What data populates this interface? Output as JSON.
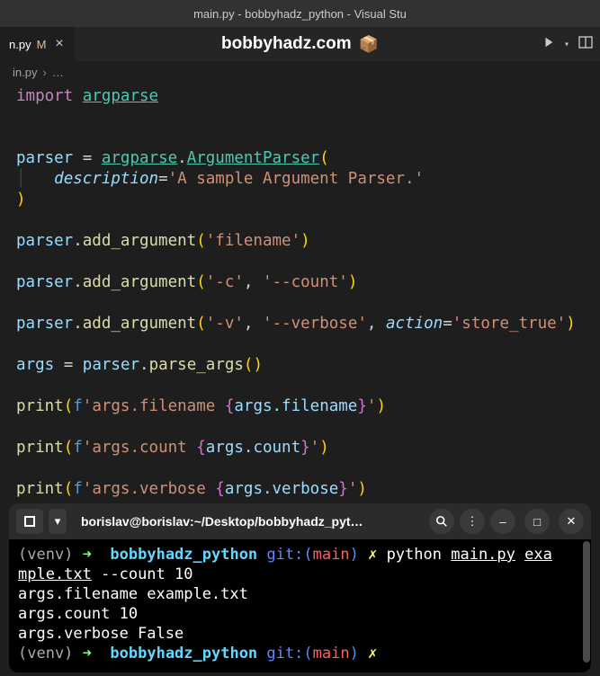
{
  "titlebar": {
    "text": "main.py - bobbyhadz_python - Visual Stu"
  },
  "tab": {
    "filename": "n.py",
    "modified_indicator": "M",
    "close_glyph": "×"
  },
  "overlay": {
    "title": "bobbyhadz.com",
    "icon": "📦"
  },
  "breadcrumb": {
    "file": "in.py",
    "sep": "›",
    "more": "…"
  },
  "code": {
    "l1_import": "import",
    "l1_mod": "argparse",
    "l3_parser": "parser",
    "l3_eq": "=",
    "l3_mod": "argparse",
    "l3_dot": ".",
    "l3_cls": "ArgumentParser",
    "l3_lp": "(",
    "l4_param": "description",
    "l4_eq": "=",
    "l4_str": "'A sample Argument Parser.'",
    "l5_rp": ")",
    "l7_var": "parser",
    "l7_dot": ".",
    "l7_fn": "add_argument",
    "l7_lp": "(",
    "l7_str": "'filename'",
    "l7_rp": ")",
    "l9_var": "parser",
    "l9_fn": "add_argument",
    "l9_str1": "'-c'",
    "l9_comma": ",",
    "l9_str2": "'--count'",
    "l11_var": "parser",
    "l11_fn": "add_argument",
    "l11_str1": "'-v'",
    "l11_str2": "'--verbose'",
    "l11_param": "action",
    "l11_str3": "'store_true'",
    "l13_args": "args",
    "l13_eq": "=",
    "l13_parser": "parser",
    "l13_fn": "parse_args",
    "l15_print": "print",
    "l15_f": "f",
    "l15_str1": "'args.filename ",
    "l15_lb": "{",
    "l15_expr": "args.filename",
    "l15_rb": "}",
    "l15_str2": "'",
    "l17_str1": "'args.count ",
    "l17_expr": "args.count",
    "l19_str1": "'args.verbose ",
    "l19_expr": "args.verbose"
  },
  "terminal": {
    "title": "borislav@borislav:~/Desktop/bobbyhadz_pyt…",
    "venv": "(venv)",
    "arrow": "➜",
    "dir": "bobbyhadz_python",
    "git_prefix": "git:(",
    "branch": "main",
    "git_suffix": ")",
    "dirty": "✗",
    "cmd_python": "python",
    "cmd_file": "main.py",
    "cmd_arg1a": "exa",
    "cmd_arg1b": "mple.txt",
    "cmd_rest": " --count 10",
    "out1": "args.filename example.txt",
    "out2": "args.count 10",
    "out3": "args.verbose False"
  },
  "icons": {
    "term_new": "⊞",
    "term_drop": "▾",
    "term_search": "search",
    "term_menu": "⋮",
    "term_min": "—",
    "term_max": "▢",
    "term_close": "✕"
  }
}
